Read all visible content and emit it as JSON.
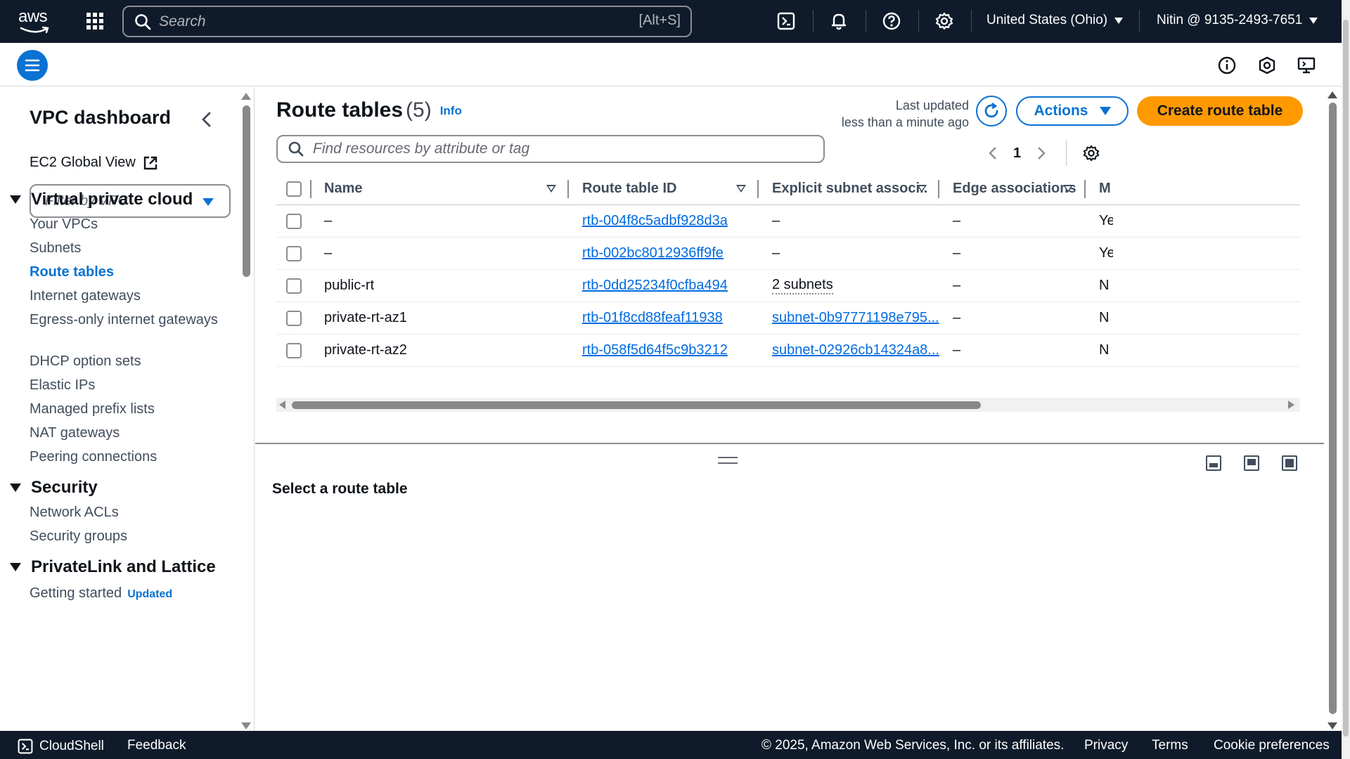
{
  "topnav": {
    "logo_text": "aws",
    "search": {
      "placeholder": "Search",
      "shortcut": "[Alt+S]"
    },
    "region": "United States (Ohio)",
    "account": "Nitin @ 9135-2493-7651",
    "icons": [
      "services-grid-icon",
      "cloudshell-icon",
      "bell-icon",
      "help-icon",
      "gear-icon"
    ]
  },
  "sidebar": {
    "title": "VPC dashboard",
    "ec2_global_view": "EC2 Global View",
    "filter_placeholder": "Filter by VPC",
    "sections": [
      {
        "title": "Virtual private cloud",
        "items": [
          "Your VPCs",
          "Subnets",
          "Route tables",
          "Internet gateways",
          "Egress-only internet gateways",
          "DHCP option sets",
          "Elastic IPs",
          "Managed prefix lists",
          "NAT gateways",
          "Peering connections"
        ]
      },
      {
        "title": "Security",
        "items": [
          "Network ACLs",
          "Security groups"
        ]
      },
      {
        "title": "PrivateLink and Lattice",
        "items": [
          "Getting started"
        ],
        "badge": "Updated"
      }
    ],
    "active_item": "Route tables"
  },
  "main": {
    "title": "Route tables",
    "count": "(5)",
    "info": "Info",
    "last_updated_label": "Last updated",
    "last_updated_value": "less than a minute ago",
    "actions_label": "Actions",
    "create_label": "Create route table",
    "find_placeholder": "Find resources by attribute or tag",
    "page": "1",
    "columns": [
      "Name",
      "Route table ID",
      "Explicit subnet associ...",
      "Edge associations",
      "M"
    ],
    "rows": [
      {
        "name": "–",
        "id": "rtb-004f8c5adbf928d3a",
        "subnet": "–",
        "edge": "–",
        "main": "Ye"
      },
      {
        "name": "–",
        "id": "rtb-002bc8012936ff9fe",
        "subnet": "–",
        "edge": "–",
        "main": "Ye"
      },
      {
        "name": "public-rt",
        "id": "rtb-0dd25234f0cfba494",
        "subnet": "2 subnets",
        "edge": "–",
        "main": "N"
      },
      {
        "name": "private-rt-az1",
        "id": "rtb-01f8cd88feaf11938",
        "subnet": "subnet-0b97771198e795...",
        "edge": "–",
        "main": "N"
      },
      {
        "name": "private-rt-az2",
        "id": "rtb-058f5d64f5c9b3212",
        "subnet": "subnet-02926cb14324a8...",
        "edge": "–",
        "main": "N"
      }
    ],
    "split_title": "Select a route table"
  },
  "footer": {
    "cloudshell": "CloudShell",
    "feedback": "Feedback",
    "copyright": "© 2025, Amazon Web Services, Inc. or its affiliates.",
    "privacy": "Privacy",
    "terms": "Terms",
    "cookies": "Cookie preferences"
  },
  "colors": {
    "nav_bg": "#0f1b2a",
    "accent": "#0972d3",
    "primary_button": "#ff9900",
    "link": "#006ce0"
  }
}
